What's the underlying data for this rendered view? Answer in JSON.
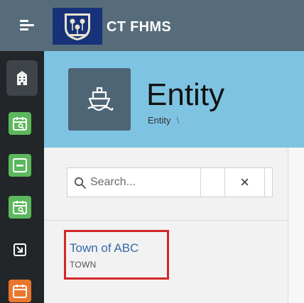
{
  "app": {
    "title": "CT FHMS",
    "logo_icon": "state-seal-icon",
    "menu_icon": "hamburger-menu-icon"
  },
  "sidebar": {
    "items": [
      {
        "name": "entity",
        "icon": "building-icon",
        "color": "#f0f0f0",
        "active": true
      },
      {
        "name": "calendar-search",
        "icon": "calendar-search-icon",
        "color": "#5cb85c"
      },
      {
        "name": "minus-box",
        "icon": "minus-box-icon",
        "color": "#5cb85c"
      },
      {
        "name": "calendar-search-2",
        "icon": "calendar-search-icon",
        "color": "#5cb85c"
      },
      {
        "name": "import",
        "icon": "arrow-import-icon",
        "color": "#ffffff"
      },
      {
        "name": "calendar-edit",
        "icon": "calendar-edit-icon",
        "color": "#e8762c"
      }
    ]
  },
  "header": {
    "title": "Entity",
    "breadcrumb": [
      "Entity"
    ],
    "breadcrumb_separator": "\\",
    "tile_icon": "ship-icon"
  },
  "search": {
    "placeholder": "Search...",
    "value": "",
    "clear_label": "×"
  },
  "results": [
    {
      "name": "Town of ABC",
      "type": "TOWN",
      "highlighted": true
    }
  ],
  "colors": {
    "topbar": "#566c7b",
    "logo_bg": "#18327a",
    "rail": "#222629",
    "header_band": "#7ec4e2",
    "entity_tile": "#4e6575",
    "link": "#3769a8",
    "highlight": "#d3262a"
  }
}
